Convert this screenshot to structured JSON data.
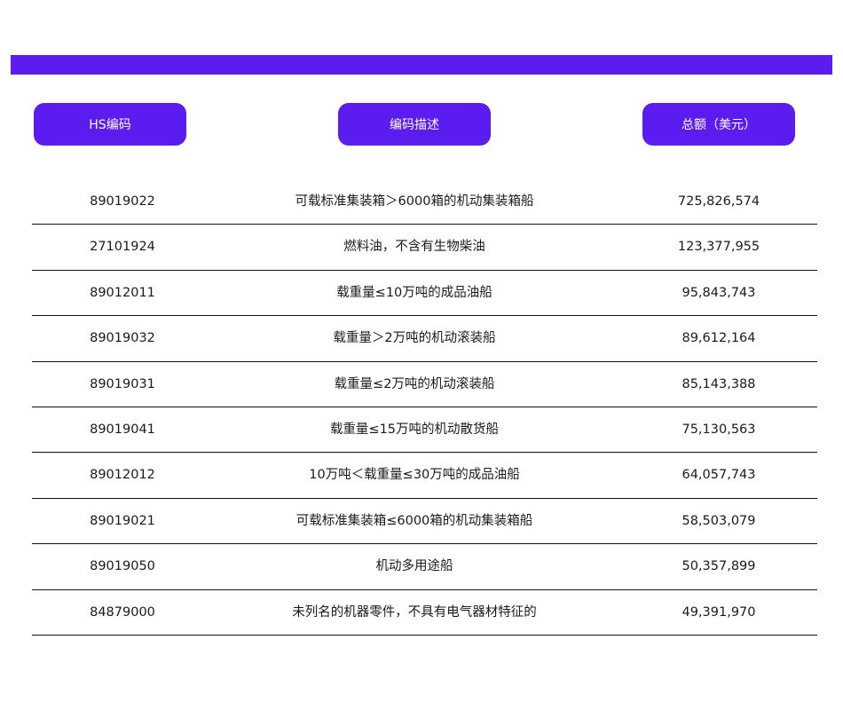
{
  "colors": {
    "accent": "#5b1cf0",
    "rule": "#111111"
  },
  "headers": {
    "code": "HS编码",
    "description": "编码描述",
    "total": "总额（美元）"
  },
  "rows": [
    {
      "code": "89019022",
      "description": "可载标准集装箱＞6000箱的机动集装箱船",
      "total": "725,826,574"
    },
    {
      "code": "27101924",
      "description": "燃料油，不含有生物柴油",
      "total": "123,377,955"
    },
    {
      "code": "89012011",
      "description": "载重量≤10万吨的成品油船",
      "total": "95,843,743"
    },
    {
      "code": "89019032",
      "description": "载重量＞2万吨的机动滚装船",
      "total": "89,612,164"
    },
    {
      "code": "89019031",
      "description": "载重量≤2万吨的机动滚装船",
      "total": "85,143,388"
    },
    {
      "code": "89019041",
      "description": "载重量≤15万吨的机动散货船",
      "total": "75,130,563"
    },
    {
      "code": "89012012",
      "description": "10万吨＜载重量≤30万吨的成品油船",
      "total": "64,057,743"
    },
    {
      "code": "89019021",
      "description": "可载标准集装箱≤6000箱的机动集装箱船",
      "total": "58,503,079"
    },
    {
      "code": "89019050",
      "description": "机动多用途船",
      "total": "50,357,899"
    },
    {
      "code": "84879000",
      "description": "未列名的机器零件，不具有电气器材特征的",
      "total": "49,391,970"
    }
  ]
}
